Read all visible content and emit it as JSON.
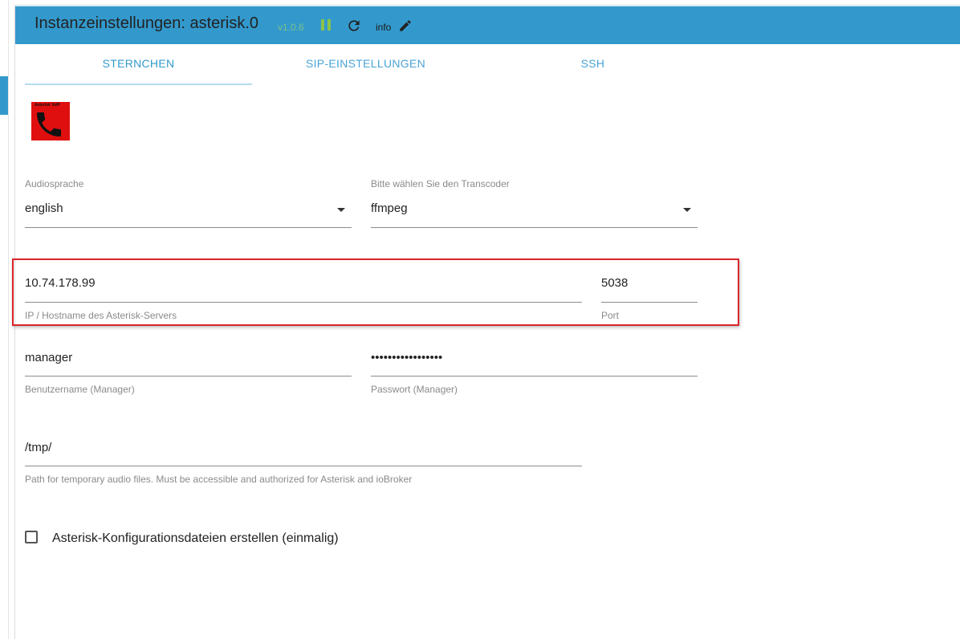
{
  "header": {
    "title": "Instanzeinstellungen: asterisk.0",
    "version": "v1.0.6",
    "info_label": "info"
  },
  "tabs": [
    {
      "label": "STERNCHEN",
      "active": true
    },
    {
      "label": "SIP-EINSTELLUNGEN",
      "active": false
    },
    {
      "label": "SSH",
      "active": false
    }
  ],
  "logo": {
    "text": "Asterisk VoIP",
    "icon": "phone-icon"
  },
  "form": {
    "audio_language": {
      "label": "Audiosprache",
      "value": "english"
    },
    "transcoder": {
      "label": "Bitte wählen Sie den Transcoder",
      "value": "ffmpeg"
    },
    "server_ip": {
      "label": "IP / Hostname des Asterisk-Servers",
      "value": "10.74.178.99"
    },
    "port": {
      "label": "Port",
      "value": "5038"
    },
    "username": {
      "label": "Benutzername (Manager)",
      "value": "manager"
    },
    "password": {
      "label": "Passwort (Manager)",
      "value": "•••••••••••••••••"
    },
    "tmp_path": {
      "label": "Path for temporary audio files. Must be accessible and authorized for Asterisk and ioBroker",
      "value": "/tmp/"
    },
    "create_config": {
      "label": "Asterisk-Konfigurationsdateien erstellen (einmalig)",
      "checked": false
    }
  },
  "colors": {
    "header_bg": "#3399cc",
    "highlight_border": "#d9252a",
    "version_green": "#7cc08a",
    "logo_red": "#e00f0f"
  }
}
